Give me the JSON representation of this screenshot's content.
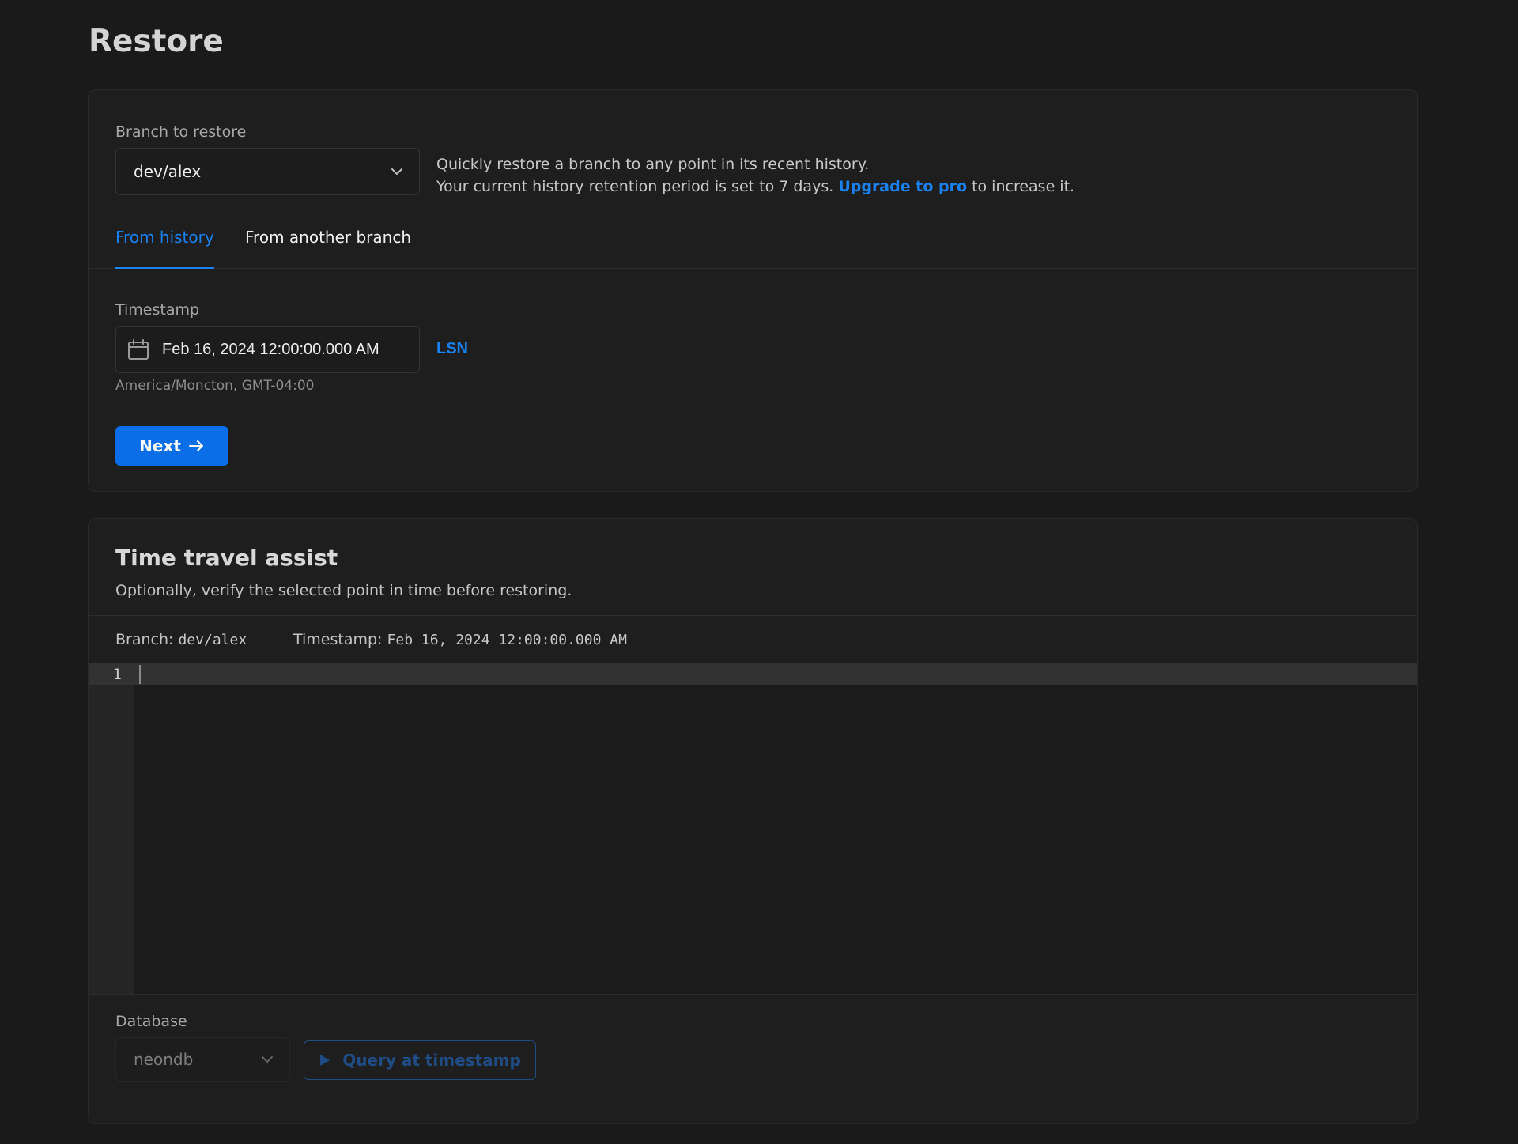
{
  "page": {
    "title": "Restore"
  },
  "restore": {
    "branch_label": "Branch to restore",
    "branch_value": "dev/alex",
    "help_line1": "Quickly restore a branch to any point in its recent history.",
    "help_line2_prefix": "Your current history retention period is set to 7 days.",
    "help_link": "Upgrade to pro",
    "help_line2_suffix": "to increase it.",
    "tabs": [
      {
        "label": "From history",
        "active": true
      },
      {
        "label": "From another branch",
        "active": false
      }
    ],
    "timestamp_label": "Timestamp",
    "timestamp_value": "Feb 16, 2024 12:00:00.000 AM",
    "lsn_label": "LSN",
    "timezone": "America/Moncton, GMT-04:00",
    "next_label": "Next"
  },
  "assist": {
    "title": "Time travel assist",
    "subtitle": "Optionally, verify the selected point in time before restoring.",
    "branch_label": "Branch:",
    "branch_value": "dev/alex",
    "timestamp_label": "Timestamp:",
    "timestamp_value": "Feb 16, 2024 12:00:00.000 AM",
    "editor": {
      "line_number": "1"
    },
    "database_label": "Database",
    "database_value": "neondb",
    "query_button": "Query at timestamp"
  },
  "colors": {
    "accent": "#1a82f0",
    "primary_button": "#0a6ee8",
    "background": "#1a1a1a",
    "card": "#1e1e1e"
  }
}
